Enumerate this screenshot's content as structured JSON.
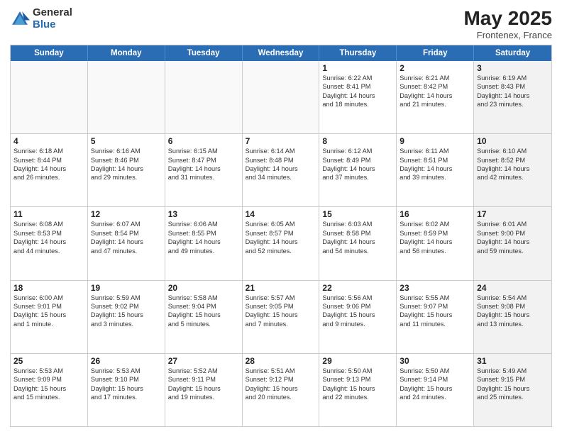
{
  "header": {
    "logo_general": "General",
    "logo_blue": "Blue",
    "main_title": "May 2025",
    "subtitle": "Frontenex, France"
  },
  "calendar": {
    "days_of_week": [
      "Sunday",
      "Monday",
      "Tuesday",
      "Wednesday",
      "Thursday",
      "Friday",
      "Saturday"
    ],
    "weeks": [
      [
        {
          "day": "",
          "empty": true
        },
        {
          "day": "",
          "empty": true
        },
        {
          "day": "",
          "empty": true
        },
        {
          "day": "",
          "empty": true
        },
        {
          "day": "1",
          "info": "Sunrise: 6:22 AM\nSunset: 8:41 PM\nDaylight: 14 hours\nand 18 minutes."
        },
        {
          "day": "2",
          "info": "Sunrise: 6:21 AM\nSunset: 8:42 PM\nDaylight: 14 hours\nand 21 minutes."
        },
        {
          "day": "3",
          "info": "Sunrise: 6:19 AM\nSunset: 8:43 PM\nDaylight: 14 hours\nand 23 minutes.",
          "shaded": true
        }
      ],
      [
        {
          "day": "4",
          "info": "Sunrise: 6:18 AM\nSunset: 8:44 PM\nDaylight: 14 hours\nand 26 minutes."
        },
        {
          "day": "5",
          "info": "Sunrise: 6:16 AM\nSunset: 8:46 PM\nDaylight: 14 hours\nand 29 minutes."
        },
        {
          "day": "6",
          "info": "Sunrise: 6:15 AM\nSunset: 8:47 PM\nDaylight: 14 hours\nand 31 minutes."
        },
        {
          "day": "7",
          "info": "Sunrise: 6:14 AM\nSunset: 8:48 PM\nDaylight: 14 hours\nand 34 minutes."
        },
        {
          "day": "8",
          "info": "Sunrise: 6:12 AM\nSunset: 8:49 PM\nDaylight: 14 hours\nand 37 minutes."
        },
        {
          "day": "9",
          "info": "Sunrise: 6:11 AM\nSunset: 8:51 PM\nDaylight: 14 hours\nand 39 minutes."
        },
        {
          "day": "10",
          "info": "Sunrise: 6:10 AM\nSunset: 8:52 PM\nDaylight: 14 hours\nand 42 minutes.",
          "shaded": true
        }
      ],
      [
        {
          "day": "11",
          "info": "Sunrise: 6:08 AM\nSunset: 8:53 PM\nDaylight: 14 hours\nand 44 minutes."
        },
        {
          "day": "12",
          "info": "Sunrise: 6:07 AM\nSunset: 8:54 PM\nDaylight: 14 hours\nand 47 minutes."
        },
        {
          "day": "13",
          "info": "Sunrise: 6:06 AM\nSunset: 8:55 PM\nDaylight: 14 hours\nand 49 minutes."
        },
        {
          "day": "14",
          "info": "Sunrise: 6:05 AM\nSunset: 8:57 PM\nDaylight: 14 hours\nand 52 minutes."
        },
        {
          "day": "15",
          "info": "Sunrise: 6:03 AM\nSunset: 8:58 PM\nDaylight: 14 hours\nand 54 minutes."
        },
        {
          "day": "16",
          "info": "Sunrise: 6:02 AM\nSunset: 8:59 PM\nDaylight: 14 hours\nand 56 minutes."
        },
        {
          "day": "17",
          "info": "Sunrise: 6:01 AM\nSunset: 9:00 PM\nDaylight: 14 hours\nand 59 minutes.",
          "shaded": true
        }
      ],
      [
        {
          "day": "18",
          "info": "Sunrise: 6:00 AM\nSunset: 9:01 PM\nDaylight: 15 hours\nand 1 minute."
        },
        {
          "day": "19",
          "info": "Sunrise: 5:59 AM\nSunset: 9:02 PM\nDaylight: 15 hours\nand 3 minutes."
        },
        {
          "day": "20",
          "info": "Sunrise: 5:58 AM\nSunset: 9:04 PM\nDaylight: 15 hours\nand 5 minutes."
        },
        {
          "day": "21",
          "info": "Sunrise: 5:57 AM\nSunset: 9:05 PM\nDaylight: 15 hours\nand 7 minutes."
        },
        {
          "day": "22",
          "info": "Sunrise: 5:56 AM\nSunset: 9:06 PM\nDaylight: 15 hours\nand 9 minutes."
        },
        {
          "day": "23",
          "info": "Sunrise: 5:55 AM\nSunset: 9:07 PM\nDaylight: 15 hours\nand 11 minutes."
        },
        {
          "day": "24",
          "info": "Sunrise: 5:54 AM\nSunset: 9:08 PM\nDaylight: 15 hours\nand 13 minutes.",
          "shaded": true
        }
      ],
      [
        {
          "day": "25",
          "info": "Sunrise: 5:53 AM\nSunset: 9:09 PM\nDaylight: 15 hours\nand 15 minutes."
        },
        {
          "day": "26",
          "info": "Sunrise: 5:53 AM\nSunset: 9:10 PM\nDaylight: 15 hours\nand 17 minutes."
        },
        {
          "day": "27",
          "info": "Sunrise: 5:52 AM\nSunset: 9:11 PM\nDaylight: 15 hours\nand 19 minutes."
        },
        {
          "day": "28",
          "info": "Sunrise: 5:51 AM\nSunset: 9:12 PM\nDaylight: 15 hours\nand 20 minutes."
        },
        {
          "day": "29",
          "info": "Sunrise: 5:50 AM\nSunset: 9:13 PM\nDaylight: 15 hours\nand 22 minutes."
        },
        {
          "day": "30",
          "info": "Sunrise: 5:50 AM\nSunset: 9:14 PM\nDaylight: 15 hours\nand 24 minutes."
        },
        {
          "day": "31",
          "info": "Sunrise: 5:49 AM\nSunset: 9:15 PM\nDaylight: 15 hours\nand 25 minutes.",
          "shaded": true
        }
      ]
    ]
  }
}
